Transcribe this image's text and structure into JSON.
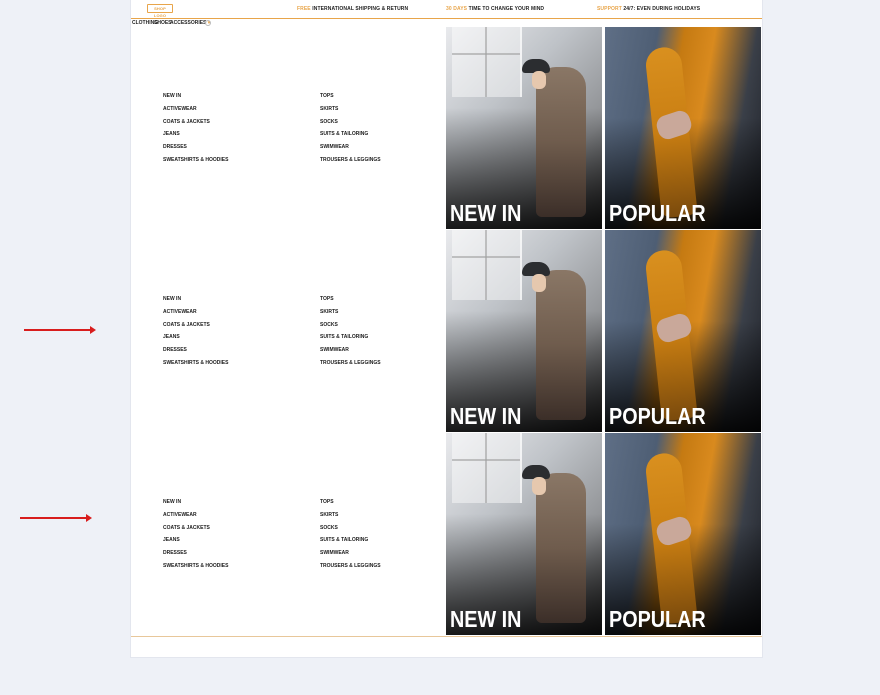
{
  "brand": {
    "logo_text": "SHOP LOGO"
  },
  "promos": [
    {
      "accent": "FREE",
      "text": " INTERNATIONAL SHIPPING & RETURN"
    },
    {
      "accent": "30 DAYS",
      "text": " TIME TO CHANGE YOUR MIND"
    },
    {
      "accent": "SUPPORT",
      "text": " 24/7: EVEN DURING HOLIDAYS"
    }
  ],
  "menu": {
    "items": [
      "CLOTHING",
      "SHOES",
      "ACCESSORIES"
    ],
    "search_icon": "search-icon",
    "chevron_icon": "chevron-down-icon"
  },
  "mega_panels": [
    {
      "left_links": [
        "NEW IN",
        "ACTIVEWEAR",
        "COATS & JACKETS",
        "JEANS",
        "DRESSES",
        "SWEATSHIRTS & HOODIES"
      ],
      "right_links": [
        "TOPS",
        "SKIRTS",
        "SOCKS",
        "SUITS & TAILORING",
        "SWIMWEAR",
        "TROUSERS & LEGGINGS"
      ],
      "tiles": [
        "NEW IN",
        "POPULAR"
      ]
    },
    {
      "left_links": [
        "NEW IN",
        "ACTIVEWEAR",
        "COATS & JACKETS",
        "JEANS",
        "DRESSES",
        "SWEATSHIRTS & HOODIES"
      ],
      "right_links": [
        "TOPS",
        "SKIRTS",
        "SOCKS",
        "SUITS & TAILORING",
        "SWIMWEAR",
        "TROUSERS & LEGGINGS"
      ],
      "tiles": [
        "NEW IN",
        "POPULAR"
      ]
    },
    {
      "left_links": [
        "NEW IN",
        "ACTIVEWEAR",
        "COATS & JACKETS",
        "JEANS",
        "DRESSES",
        "SWEATSHIRTS & HOODIES"
      ],
      "right_links": [
        "TOPS",
        "SKIRTS",
        "SOCKS",
        "SUITS & TAILORING",
        "SWIMWEAR",
        "TROUSERS & LEGGINGS"
      ],
      "tiles": [
        "NEW IN",
        "POPULAR"
      ]
    }
  ],
  "colors": {
    "accent": "#e8a54a",
    "arrow": "#d81d1d",
    "background": "#eef1f7"
  }
}
